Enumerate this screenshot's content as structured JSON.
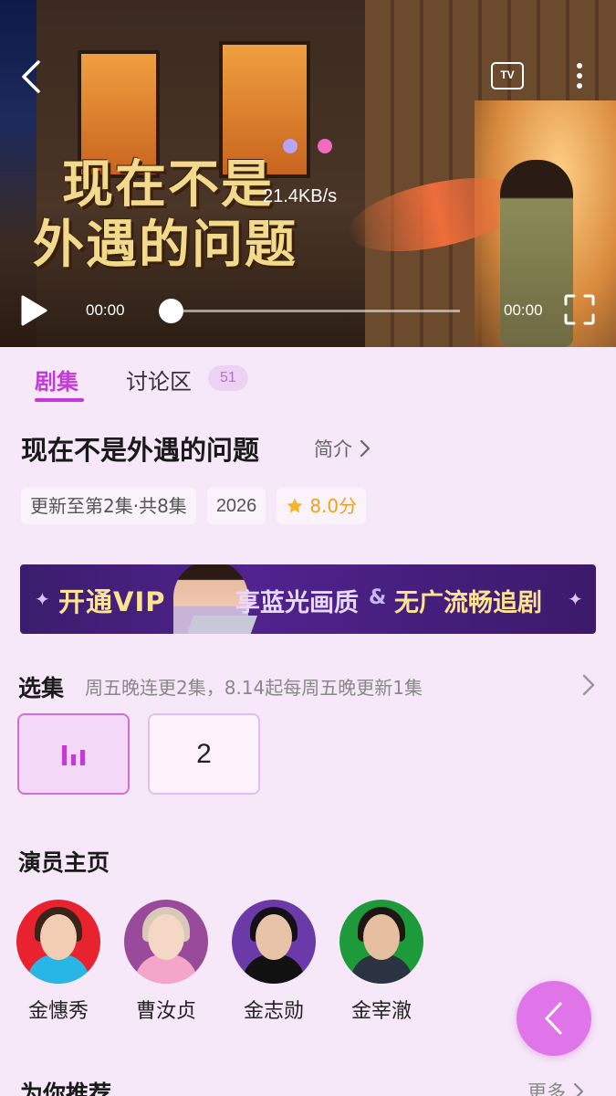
{
  "player": {
    "poster_title_line1": "现在不是",
    "poster_title_line2": "外遇的问题",
    "network_speed": "21.4KB/s",
    "current_time": "00:00",
    "total_time": "00:00",
    "progress": 0,
    "tv_label": "TV",
    "page_dots": [
      "#b9a3f5",
      "#f26bc0"
    ]
  },
  "tabs": {
    "episodes": "剧集",
    "discussion": "讨论区",
    "discussion_count": "51"
  },
  "show": {
    "title": "现在不是外遇的问题",
    "intro_link": "简介",
    "update_status": "更新至第2集·共8集",
    "year": "2026",
    "rating": "8.0分"
  },
  "vip_banner": {
    "text_open": "开通VIP",
    "text_quality": "享蓝光画质",
    "amp": "&",
    "text_noads": "无广流畅追剧"
  },
  "episodes": {
    "heading": "选集",
    "schedule_note": "周五晚连更2集，8.14起每周五晚更新1集",
    "items": [
      {
        "label": "",
        "playing": true
      },
      {
        "label": "2",
        "playing": false
      }
    ]
  },
  "actors": {
    "heading": "演员主页",
    "list": [
      {
        "name": "金憓秀",
        "bg": "#e8222e"
      },
      {
        "name": "曹汝贞",
        "bg": "#9a4a9a"
      },
      {
        "name": "金志勋",
        "bg": "#6a3aa8"
      },
      {
        "name": "金宰澈",
        "bg": "#1d9a3a"
      }
    ]
  },
  "recommend": {
    "heading": "为你推荐",
    "more": "更多"
  },
  "colors": {
    "accent": "#c23bd8",
    "background": "#f6e8f8",
    "fab": "#df75e8",
    "rating": "#f0a020"
  }
}
